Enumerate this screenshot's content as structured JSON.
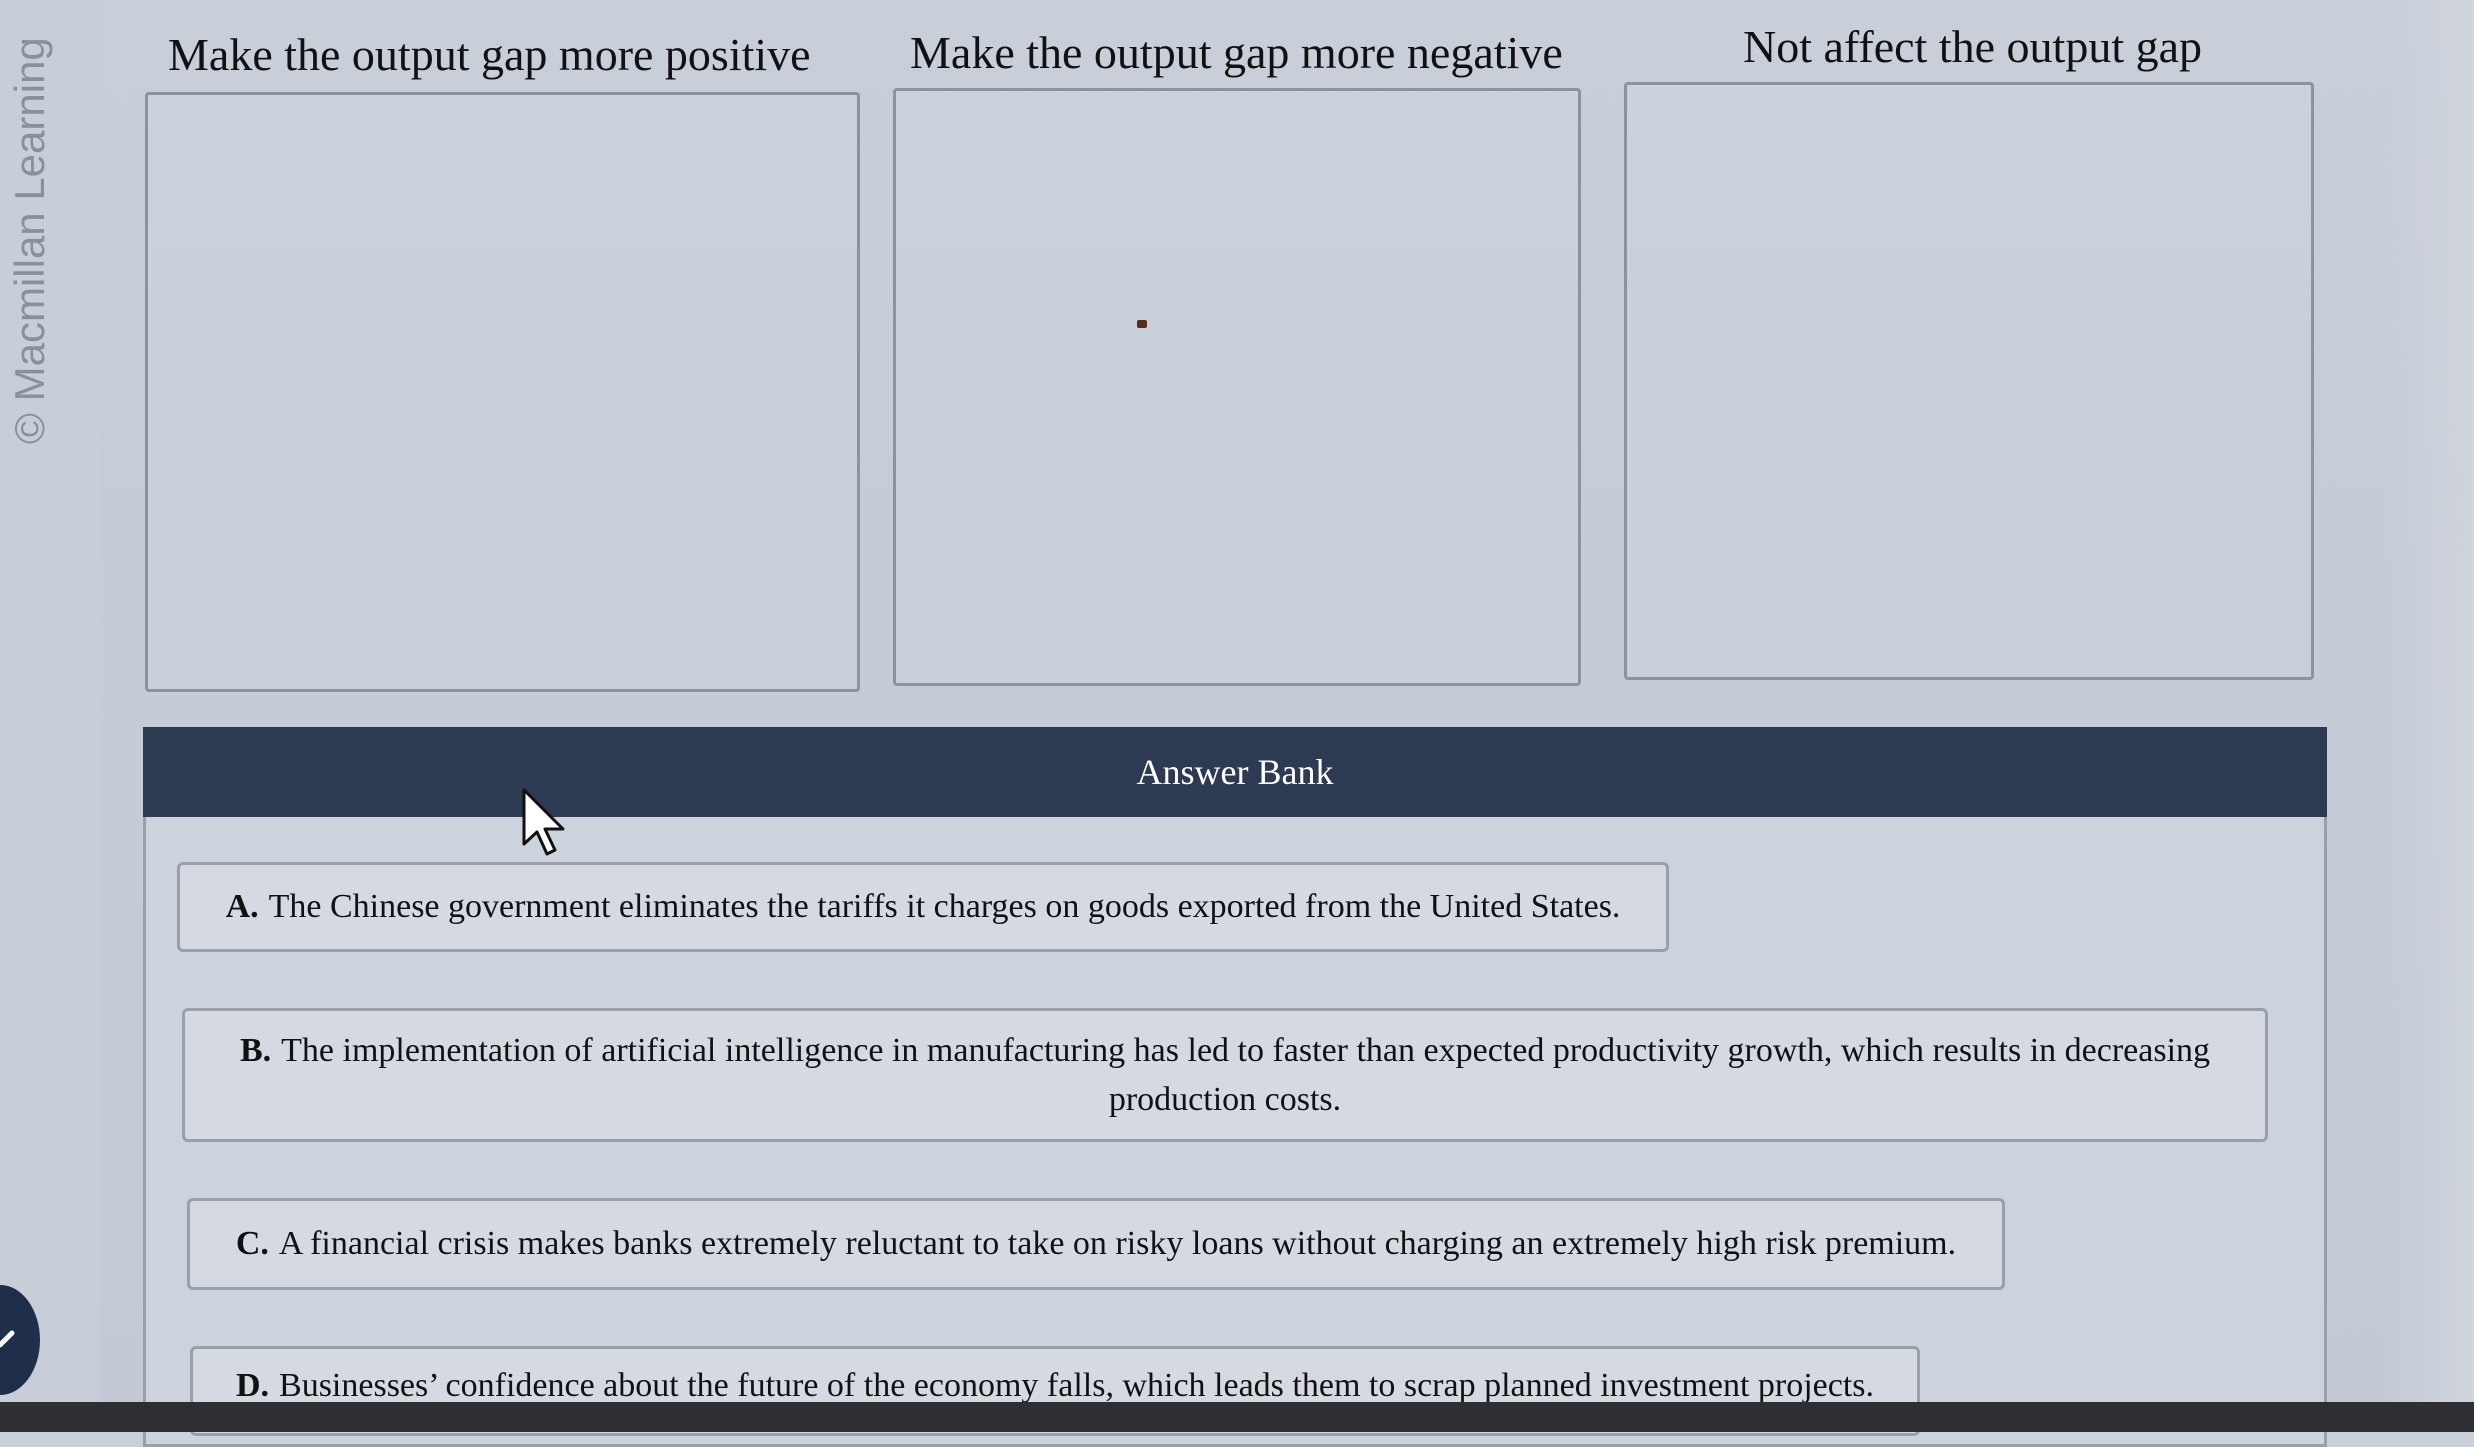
{
  "watermark": "© Macmillan Learning",
  "bins": [
    {
      "title": "Make the output gap more positive"
    },
    {
      "title": "Make the output gap more negative"
    },
    {
      "title": "Not affect the output gap"
    }
  ],
  "answer_bank": {
    "title": "Answer Bank",
    "items": [
      {
        "letter": "A.",
        "text": "The Chinese government eliminates the tariffs it charges on goods exported from the United States."
      },
      {
        "letter": "B.",
        "text": "The implementation of artificial intelligence in manufacturing has led to faster than expected productivity growth, which results in decreasing production costs."
      },
      {
        "letter": "C.",
        "text": "A financial crisis makes banks extremely reluctant to take on risky loans without charging an extremely high risk premium."
      },
      {
        "letter": "D.",
        "text": "Businesses’ confidence about the future of the economy falls, which leads them to scrap planned investment projects."
      }
    ]
  },
  "icons": {
    "cursor": "mouse-pointer-icon",
    "check": "checkmark-icon"
  }
}
